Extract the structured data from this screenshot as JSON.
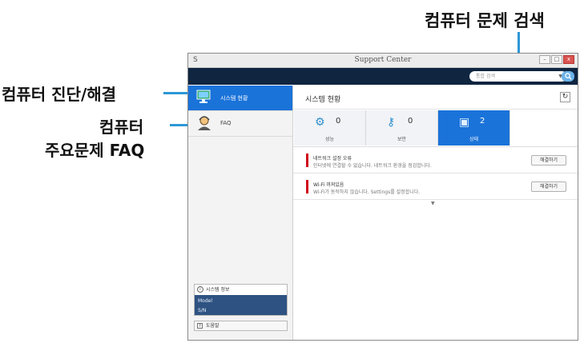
{
  "callouts": {
    "search": "컴퓨터 문제 검색",
    "diagnose": "컴퓨터 진단/해결",
    "faq_line1": "컴퓨터",
    "faq_line2": "주요문제 FAQ"
  },
  "window": {
    "title": "Support Center",
    "app_icon": "S",
    "controls": [
      "–",
      "□",
      "x"
    ]
  },
  "search": {
    "placeholder": "통합 검색",
    "button_icon": "search-icon"
  },
  "sidebar": {
    "items": [
      {
        "label": "시스템 현황",
        "icon": "monitor-icon",
        "active": true
      },
      {
        "label": "FAQ",
        "icon": "faq-person-icon",
        "active": false
      }
    ],
    "system_info": {
      "heading": "시스템 정보",
      "model_label": "Model",
      "serial_label": "S/N"
    },
    "help_label": "도움말"
  },
  "main": {
    "title": "시스템 현황",
    "refresh_icon": "refresh-icon",
    "tiles": [
      {
        "label": "성능",
        "count": "0",
        "icon": "gears-icon",
        "active": false
      },
      {
        "label": "보안",
        "count": "0",
        "icon": "security-key-icon",
        "active": false
      },
      {
        "label": "상태",
        "count": "2",
        "icon": "status-monitor-icon",
        "active": true
      }
    ],
    "alerts": [
      {
        "title": "네트워크 설정 오류",
        "description": "인터넷에 연결할 수 없습니다. 네트워크 환경을 점검합니다.",
        "button": "해결하기"
      },
      {
        "title": "Wi-Fi 꺼져있음",
        "description": "Wi-Fi가 동작하지 않습니다. Settings를 설정합니다.",
        "button": "해결하기"
      }
    ],
    "more_caret": "▼"
  },
  "colors": {
    "accent_blue": "#1a73d9",
    "leader_blue": "#2d97d6",
    "search_bar": "#0f2540",
    "alert_red": "#d0021b"
  }
}
